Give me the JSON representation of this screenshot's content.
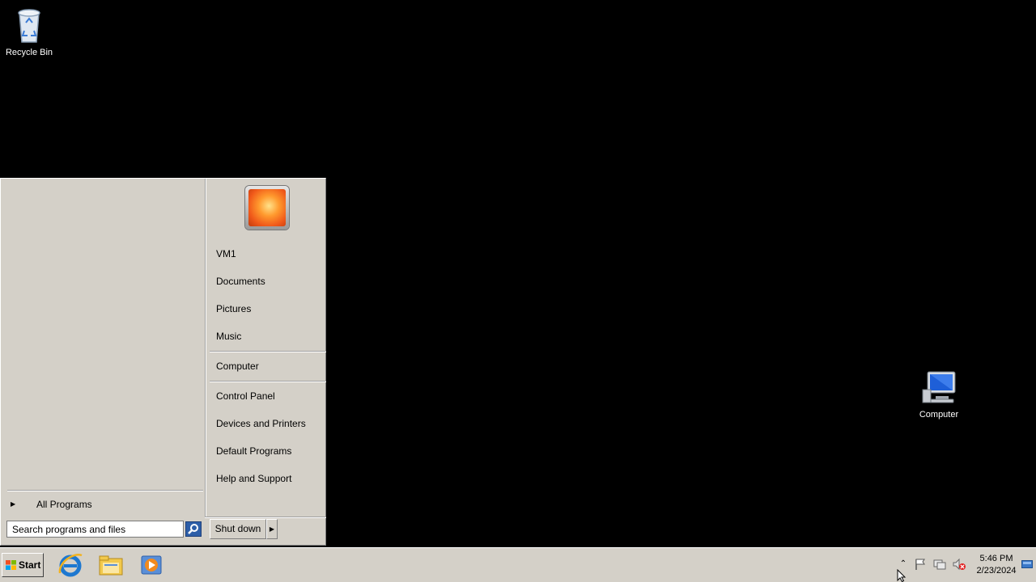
{
  "desktop": {
    "recycle_bin_label": "Recycle Bin",
    "computer_label": "Computer"
  },
  "start_menu": {
    "all_programs": "All Programs",
    "right_items": {
      "user": "VM1",
      "documents": "Documents",
      "pictures": "Pictures",
      "music": "Music",
      "computer": "Computer",
      "control_panel": "Control Panel",
      "devices_printers": "Devices and Printers",
      "default_programs": "Default Programs",
      "help_support": "Help and Support"
    },
    "search_placeholder": "Search programs and files",
    "shutdown_label": "Shut down"
  },
  "taskbar": {
    "start_label": "Start",
    "pinned": [
      "internet-explorer-icon",
      "windows-explorer-icon",
      "media-player-icon"
    ],
    "clock_time": "5:46 PM",
    "clock_date": "2/23/2024"
  },
  "colors": {
    "desktop_bg": "#000000",
    "classic_gray": "#d4d0c8",
    "ie_blue": "#1e78d0",
    "folder_yellow": "#f2c94c",
    "media_orange": "#f28a1e"
  }
}
